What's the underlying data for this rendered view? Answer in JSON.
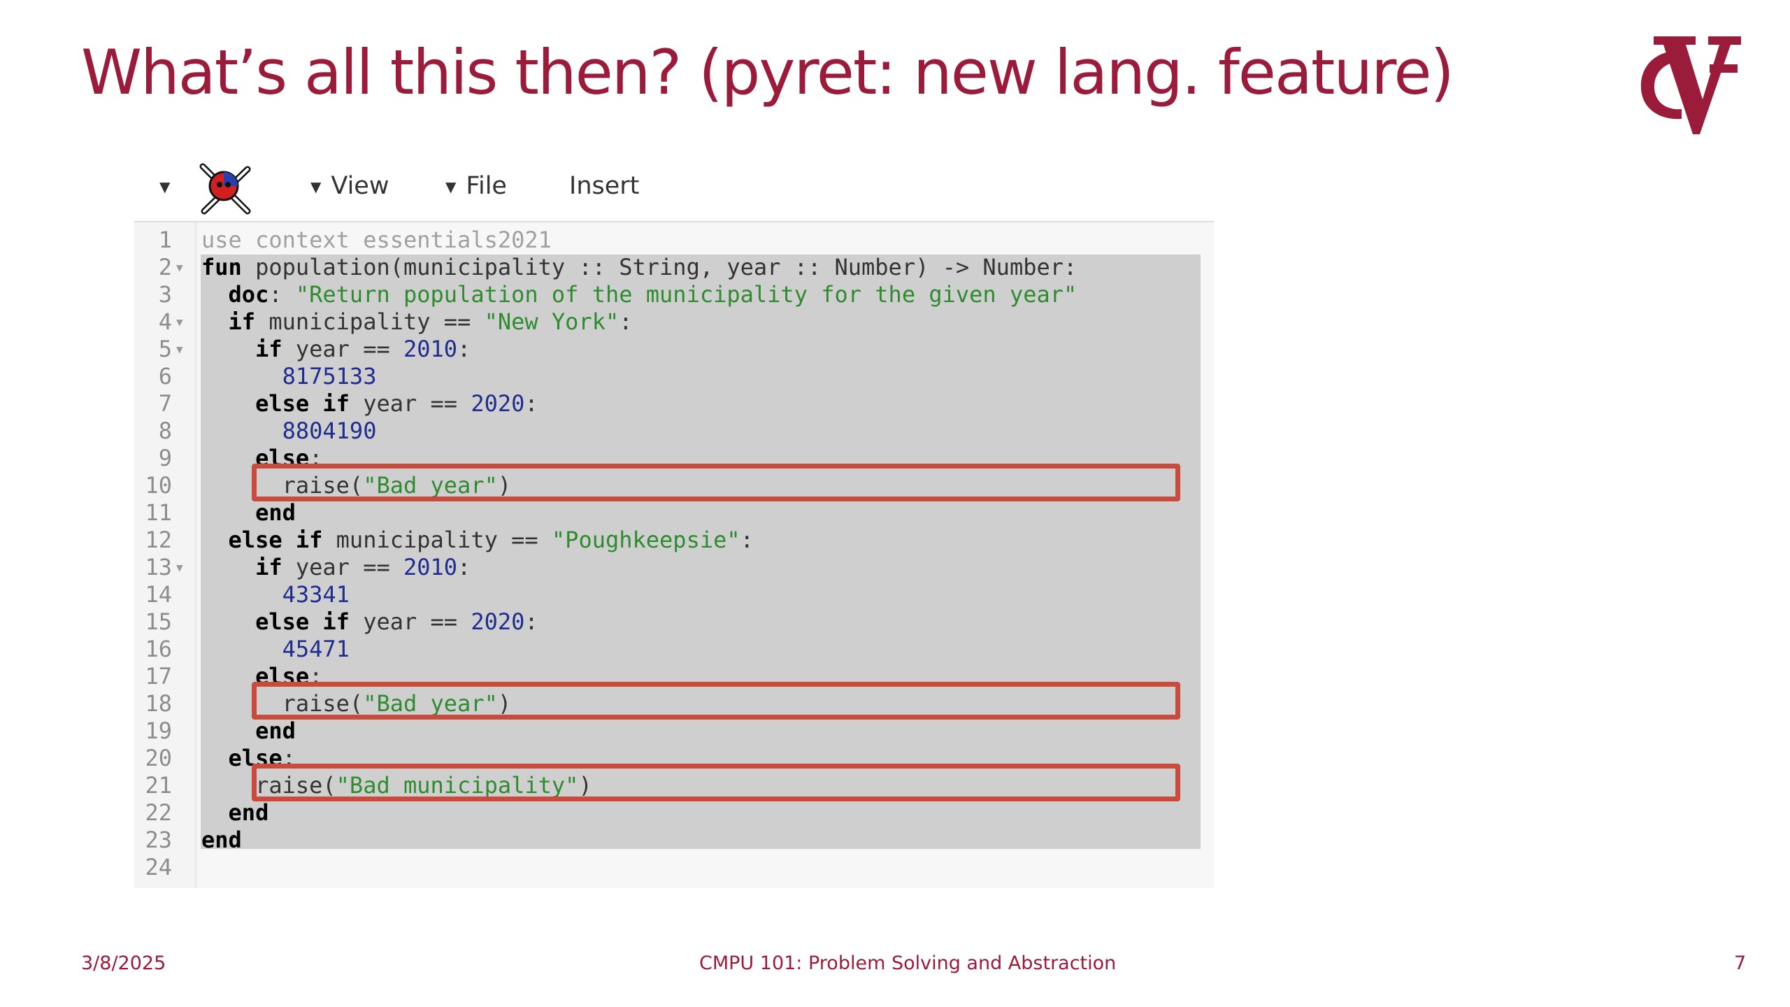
{
  "slide": {
    "title": "What’s all this then? (pyret: new lang. feature)",
    "date": "3/8/2025",
    "course": "CMPU 101: Problem Solving and Abstraction",
    "page_number": "7",
    "accent_color": "#9b1b3a",
    "logo_icon": "vassar-vc-logo"
  },
  "toolbar": {
    "menu_caret_icon": "caret-down-icon",
    "app_icon": "pyret-skull-crossbones-icon",
    "view_label": "View",
    "file_label": "File",
    "insert_label": "Insert"
  },
  "editor": {
    "line_numbers": [
      "1",
      "2",
      "3",
      "4",
      "5",
      "6",
      "7",
      "8",
      "9",
      "10",
      "11",
      "12",
      "13",
      "14",
      "15",
      "16",
      "17",
      "18",
      "19",
      "20",
      "21",
      "22",
      "23",
      "24"
    ],
    "foldable_lines": [
      "2",
      "4",
      "5",
      "13"
    ],
    "lines": [
      [
        [
          "cmt",
          "use context essentials2021"
        ]
      ],
      [
        [
          "kw",
          "fun"
        ],
        [
          "typ",
          " population(municipality :: String, year :: Number) -> Number:"
        ]
      ],
      [
        [
          "typ",
          "  "
        ],
        [
          "kw",
          "doc"
        ],
        [
          "typ",
          ": "
        ],
        [
          "str",
          "\"Return population of the municipality for the given year\""
        ]
      ],
      [
        [
          "typ",
          "  "
        ],
        [
          "kw",
          "if"
        ],
        [
          "typ",
          " municipality == "
        ],
        [
          "str",
          "\"New York\""
        ],
        [
          "typ",
          ":"
        ]
      ],
      [
        [
          "typ",
          "    "
        ],
        [
          "kw",
          "if"
        ],
        [
          "typ",
          " year == "
        ],
        [
          "num",
          "2010"
        ],
        [
          "typ",
          ":"
        ]
      ],
      [
        [
          "num",
          "      8175133"
        ]
      ],
      [
        [
          "typ",
          "    "
        ],
        [
          "kw",
          "else if"
        ],
        [
          "typ",
          " year == "
        ],
        [
          "num",
          "2020"
        ],
        [
          "typ",
          ":"
        ]
      ],
      [
        [
          "num",
          "      8804190"
        ]
      ],
      [
        [
          "typ",
          "    "
        ],
        [
          "kw",
          "else"
        ],
        [
          "typ",
          ":"
        ]
      ],
      [
        [
          "typ",
          "      raise("
        ],
        [
          "str",
          "\"Bad year\""
        ],
        [
          "typ",
          ")"
        ]
      ],
      [
        [
          "typ",
          "    "
        ],
        [
          "kw",
          "end"
        ]
      ],
      [
        [
          "typ",
          "  "
        ],
        [
          "kw",
          "else if"
        ],
        [
          "typ",
          " municipality == "
        ],
        [
          "str",
          "\"Poughkeepsie\""
        ],
        [
          "typ",
          ":"
        ]
      ],
      [
        [
          "typ",
          "    "
        ],
        [
          "kw",
          "if"
        ],
        [
          "typ",
          " year == "
        ],
        [
          "num",
          "2010"
        ],
        [
          "typ",
          ":"
        ]
      ],
      [
        [
          "num",
          "      43341"
        ]
      ],
      [
        [
          "typ",
          "    "
        ],
        [
          "kw",
          "else if"
        ],
        [
          "typ",
          " year == "
        ],
        [
          "num",
          "2020"
        ],
        [
          "typ",
          ":"
        ]
      ],
      [
        [
          "num",
          "      45471"
        ]
      ],
      [
        [
          "typ",
          "    "
        ],
        [
          "kw",
          "else"
        ],
        [
          "typ",
          ":"
        ]
      ],
      [
        [
          "typ",
          "      raise("
        ],
        [
          "str",
          "\"Bad year\""
        ],
        [
          "typ",
          ")"
        ]
      ],
      [
        [
          "typ",
          "    "
        ],
        [
          "kw",
          "end"
        ]
      ],
      [
        [
          "typ",
          "  "
        ],
        [
          "kw",
          "else"
        ],
        [
          "typ",
          ":"
        ]
      ],
      [
        [
          "typ",
          "    raise("
        ],
        [
          "str",
          "\"Bad municipality\""
        ],
        [
          "typ",
          ")"
        ]
      ],
      [
        [
          "typ",
          "  "
        ],
        [
          "kw",
          "end"
        ]
      ],
      [
        [
          "kw",
          "end"
        ]
      ],
      [
        [
          "typ",
          ""
        ]
      ]
    ],
    "highlighted_lines": [
      "10",
      "18",
      "21"
    ],
    "highlight_color": "#c84b3e"
  }
}
